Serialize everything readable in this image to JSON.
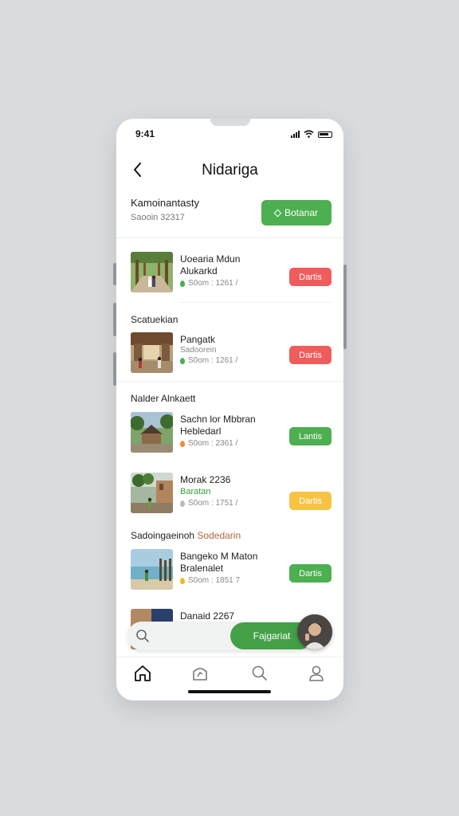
{
  "status_bar": {
    "time": "9:41"
  },
  "header": {
    "title": "Nidariga"
  },
  "summary": {
    "title": "Kamoinantasty",
    "subtitle": "Saooin 32317",
    "button_label": "Botanar"
  },
  "items": [
    {
      "title_line1": "Uoearia Mdun",
      "title_line2": "Alukarkd",
      "subline": "",
      "meta": "S0om : 1261 /",
      "dot_color": "#4caf50",
      "badge": "Dartis",
      "badge_color": "#ef5c5c"
    },
    {
      "title_line1": "Pangatk",
      "title_line2": "",
      "subline": "Sadoorein",
      "meta": "S0om : 1261 /",
      "dot_color": "#4caf50",
      "badge": "Dartis",
      "badge_color": "#ef5c5c"
    },
    {
      "title_line1": "Sachn lor Mbbran",
      "title_line2": "Hebledarl",
      "subline": "",
      "meta": "S0om : 2361 /",
      "dot_color": "#f08c3a",
      "badge": "Lantis",
      "badge_color": "#4caf50"
    },
    {
      "title_line1": "Morak 2236",
      "title_line2": "",
      "subline_green": "Baratan",
      "meta": "S0om : 1751 /",
      "dot_color": "#bbbbbb",
      "badge": "Dartis",
      "badge_color": "#f6c343"
    },
    {
      "title_line1": "Bangeko M Maton",
      "title_line2": "Bralenalet",
      "subline": "",
      "meta": "S0om : 1851 7",
      "dot_color": "#f0b92a",
      "badge": "Dartis",
      "badge_color": "#4caf50"
    },
    {
      "title_line1": "Danaid 2267",
      "title_line2": "",
      "subline": "",
      "meta": "",
      "dot_color": "",
      "badge": "",
      "badge_color": ""
    }
  ],
  "sections": {
    "s1": "Scatuekian",
    "s2": "Nalder Alnkaett",
    "s3_dark": "Sadoingaeinoh",
    "s3_accent": "Sodedarin"
  },
  "search": {
    "button_label": "Fajgariat"
  },
  "colors": {
    "accent": "#4caf50",
    "red_badge": "#ef5c5c",
    "yellow_badge": "#f6c343"
  },
  "tabs": [
    "home-icon",
    "explore-icon",
    "search-icon",
    "profile-icon"
  ]
}
